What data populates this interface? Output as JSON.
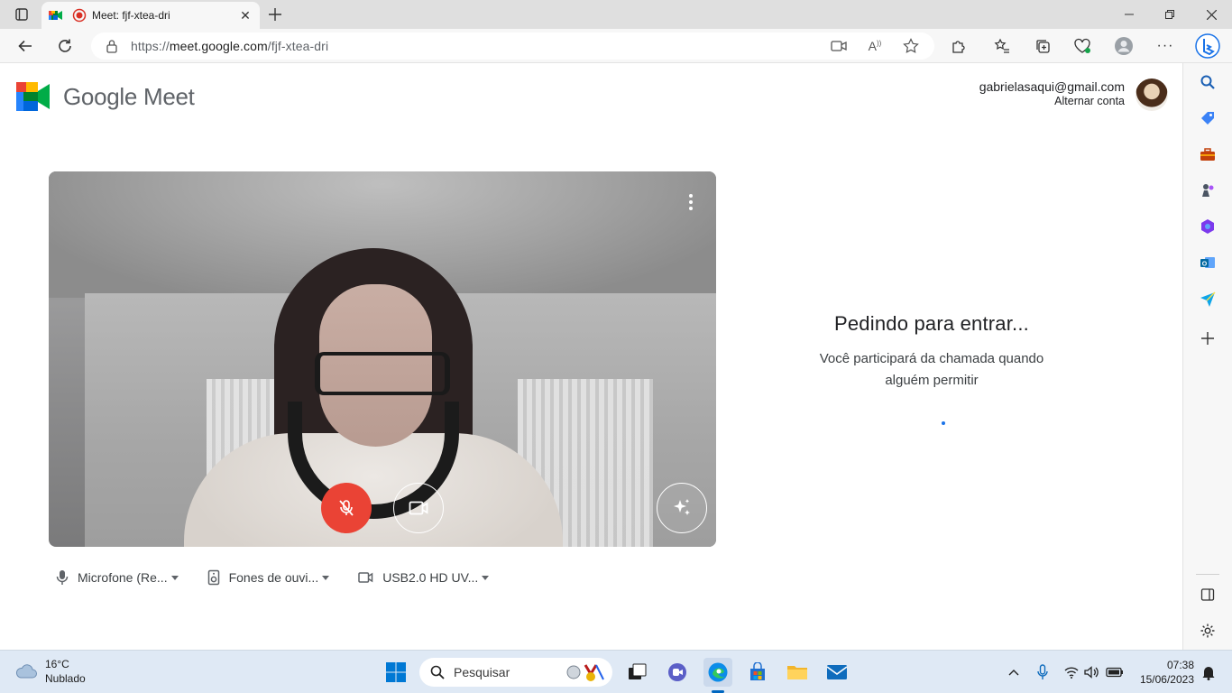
{
  "browser": {
    "tab_title": "Meet: fjf-xtea-dri",
    "url_prefix": "https://",
    "url_host": "meet.google.com",
    "url_path": "/fjf-xtea-dri"
  },
  "meet": {
    "wordmark": "Google Meet",
    "account_email": "gabrielasaqui@gmail.com",
    "switch_account": "Alternar conta",
    "join_heading": "Pedindo para entrar...",
    "join_sub_line1": "Você participará da chamada quando",
    "join_sub_line2": "alguém permitir",
    "devices": {
      "microphone": "Microfone (Re...",
      "speaker": "Fones de ouvi...",
      "camera": "USB2.0 HD UV..."
    },
    "colors": {
      "mic_off": "#ea4335",
      "accent": "#1a73e8"
    }
  },
  "taskbar": {
    "temperature": "16°C",
    "condition": "Nublado",
    "search_placeholder": "Pesquisar",
    "time": "07:38",
    "date": "15/06/2023"
  }
}
